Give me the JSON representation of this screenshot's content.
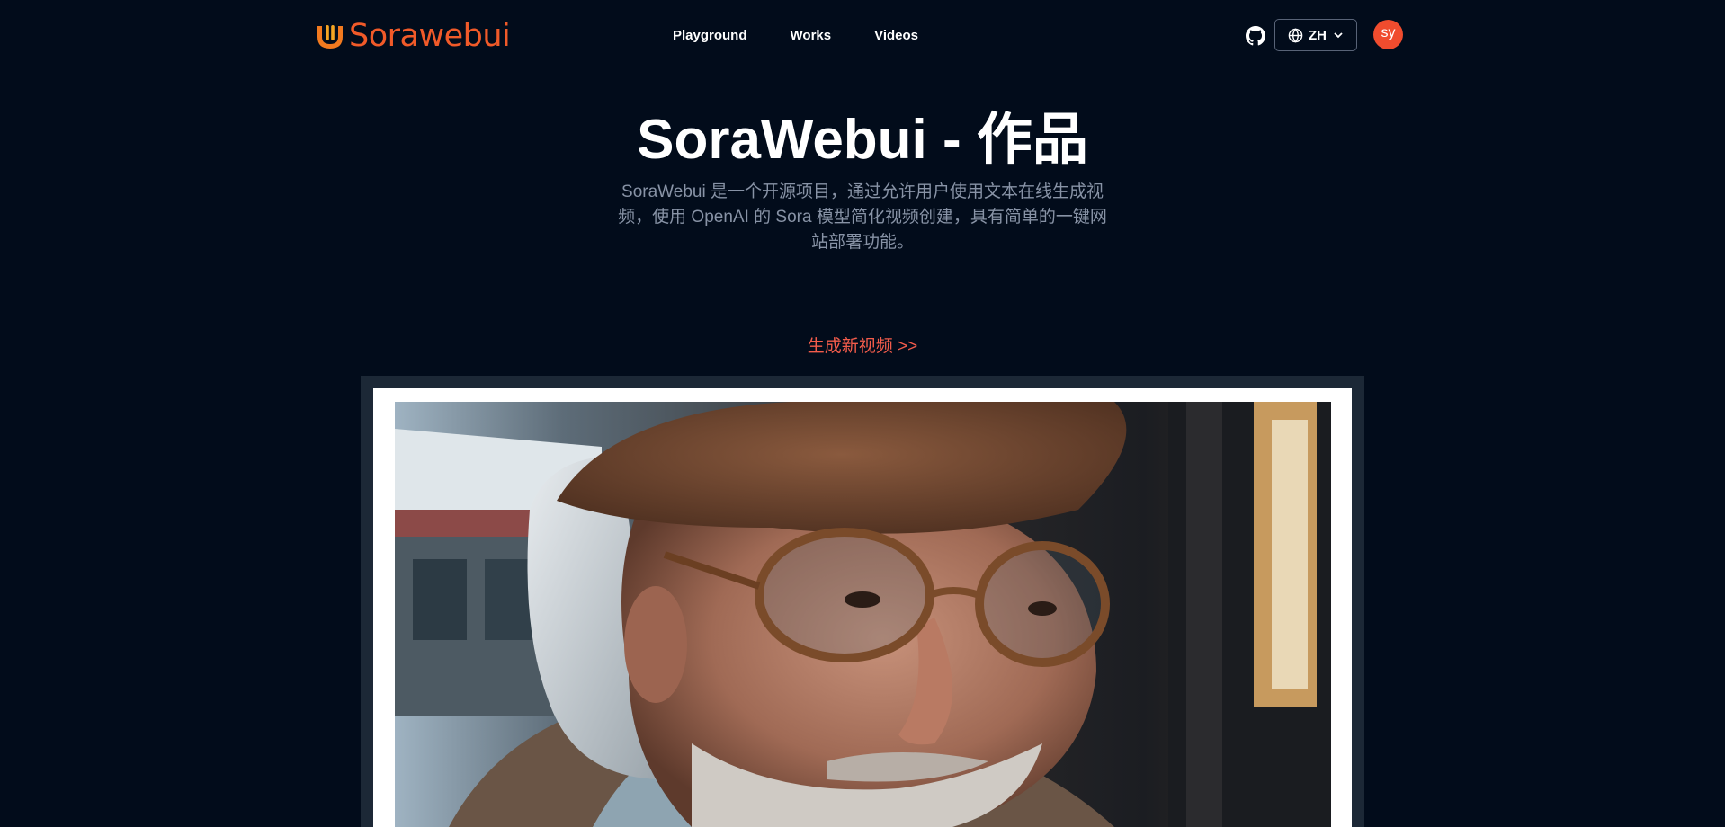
{
  "brand": {
    "name": "Sorawebui",
    "accent": "#f15a29"
  },
  "nav": {
    "items": [
      {
        "label": "Playground"
      },
      {
        "label": "Works"
      },
      {
        "label": "Videos"
      }
    ]
  },
  "header": {
    "github_icon": "github-icon",
    "language": {
      "selected": "ZH",
      "icon": "globe-icon"
    },
    "user": {
      "initials": "sy",
      "avatar_color": "#f04c2e"
    }
  },
  "hero": {
    "title": "SoraWebui - 作品",
    "description": "SoraWebui 是一个开源项目，通过允许用户使用文本在线生成视频，使用 OpenAI 的 Sora 模型简化视频创建，具有简单的一键网站部署功能。",
    "cta": "生成新视频 >>",
    "cta_color": "#f25c4b"
  },
  "video": {
    "subject": "close-up of an elderly man with grey hair and beard wearing a brown beret and round tortoiseshell glasses"
  },
  "colors": {
    "background": "#020c1b",
    "muted_text": "#8893a6"
  }
}
